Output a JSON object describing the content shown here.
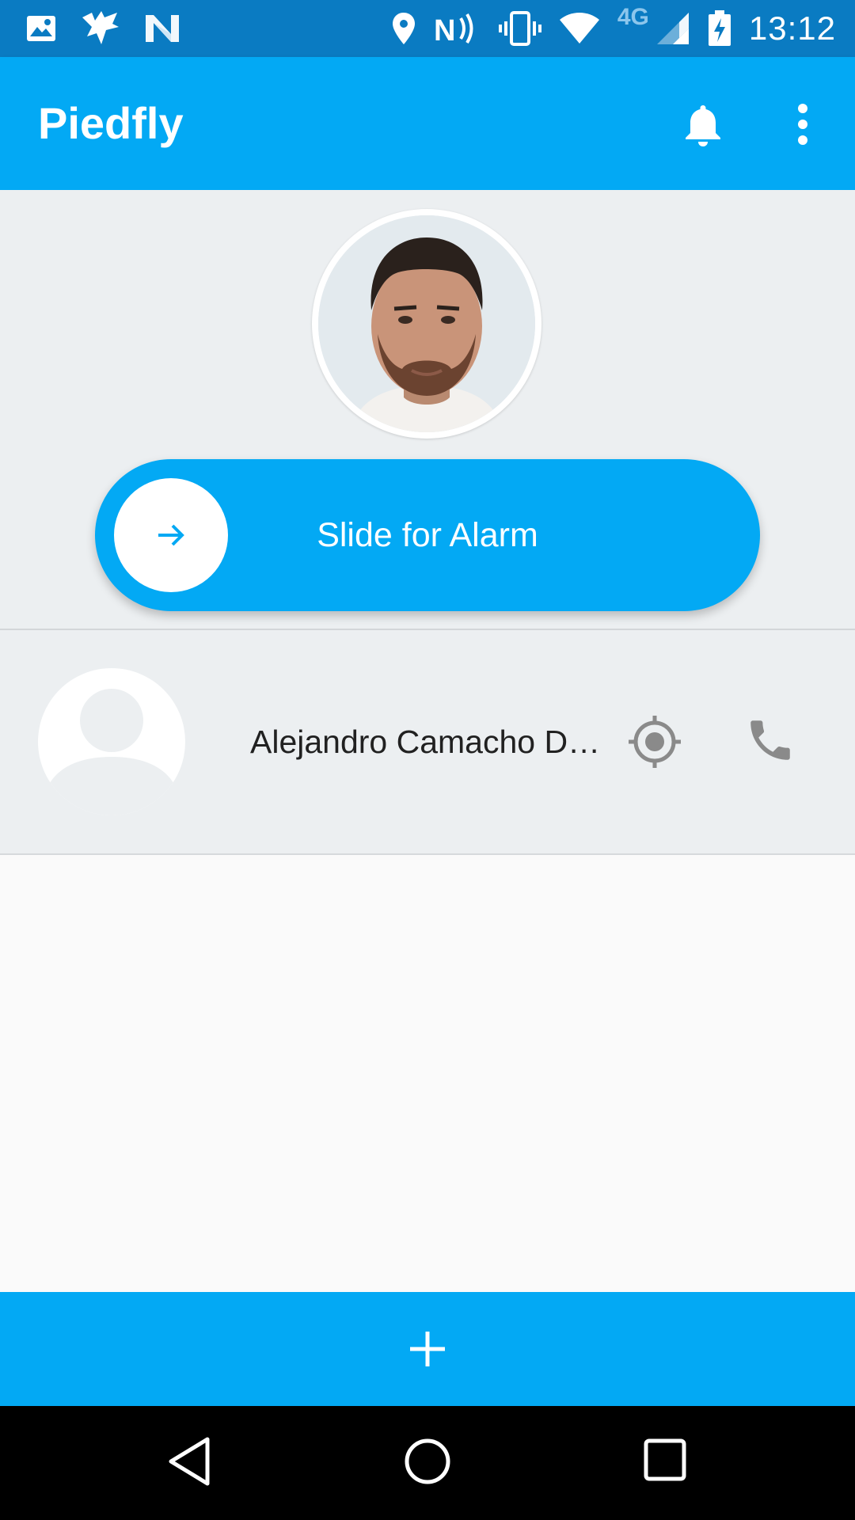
{
  "status_bar": {
    "time": "13:12",
    "network_label": "4G",
    "icons_left": [
      "image-icon",
      "bird-icon",
      "n-logo-icon"
    ],
    "icons_right": [
      "location-icon",
      "nfc-icon",
      "vibrate-icon",
      "wifi-icon",
      "signal-icon",
      "battery-charging-icon"
    ]
  },
  "app_bar": {
    "title": "Piedfly",
    "actions": [
      "bell-icon",
      "more-vert-icon"
    ]
  },
  "profile": {
    "avatar": "profile-photo"
  },
  "alarm_slider": {
    "label": "Slide for Alarm",
    "knob_icon": "arrow-right-icon"
  },
  "contacts": [
    {
      "name": "Alejandro Camacho Dí...",
      "avatar": "person-placeholder-icon",
      "actions": [
        "locate-icon",
        "phone-icon"
      ]
    }
  ],
  "add_button": {
    "icon": "plus-icon"
  },
  "nav_bar": {
    "buttons": [
      "back-icon",
      "home-icon",
      "recents-icon"
    ]
  },
  "colors": {
    "status_bar": "#0a7bc2",
    "primary": "#03a9f4",
    "surface": "#eceff1",
    "background": "#fafafa",
    "icon_grey": "#8a8a8a"
  }
}
